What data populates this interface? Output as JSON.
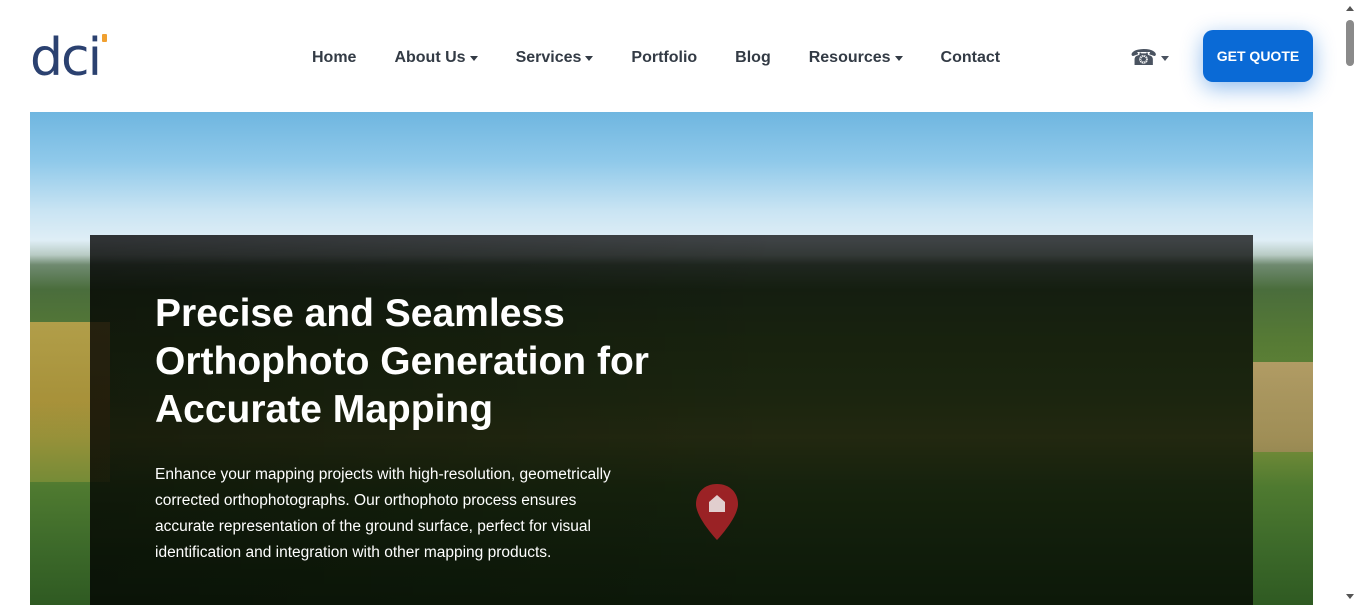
{
  "brand": {
    "logo_text": "dci",
    "accent": "#f0a030",
    "primary": "#2b4170"
  },
  "nav": {
    "items": [
      {
        "label": "Home",
        "dropdown": false
      },
      {
        "label": "About Us",
        "dropdown": true
      },
      {
        "label": "Services",
        "dropdown": true
      },
      {
        "label": "Portfolio",
        "dropdown": false
      },
      {
        "label": "Blog",
        "dropdown": false
      },
      {
        "label": "Resources",
        "dropdown": true
      },
      {
        "label": "Contact",
        "dropdown": false
      }
    ],
    "phone_icon": "telephone-icon",
    "cta_label": "GET QUOTE",
    "cta_color": "#0a6ad6"
  },
  "hero": {
    "title": "Precise and Seamless Orthophoto Generation for Accurate Mapping",
    "description": "Enhance your mapping projects with high-resolution, geometrically corrected orthophotographs. Our orthophoto process ensures accurate representation of the ground surface, perfect for visual identification and integration with other mapping products.",
    "pin_icon": "map-pin-icon"
  }
}
